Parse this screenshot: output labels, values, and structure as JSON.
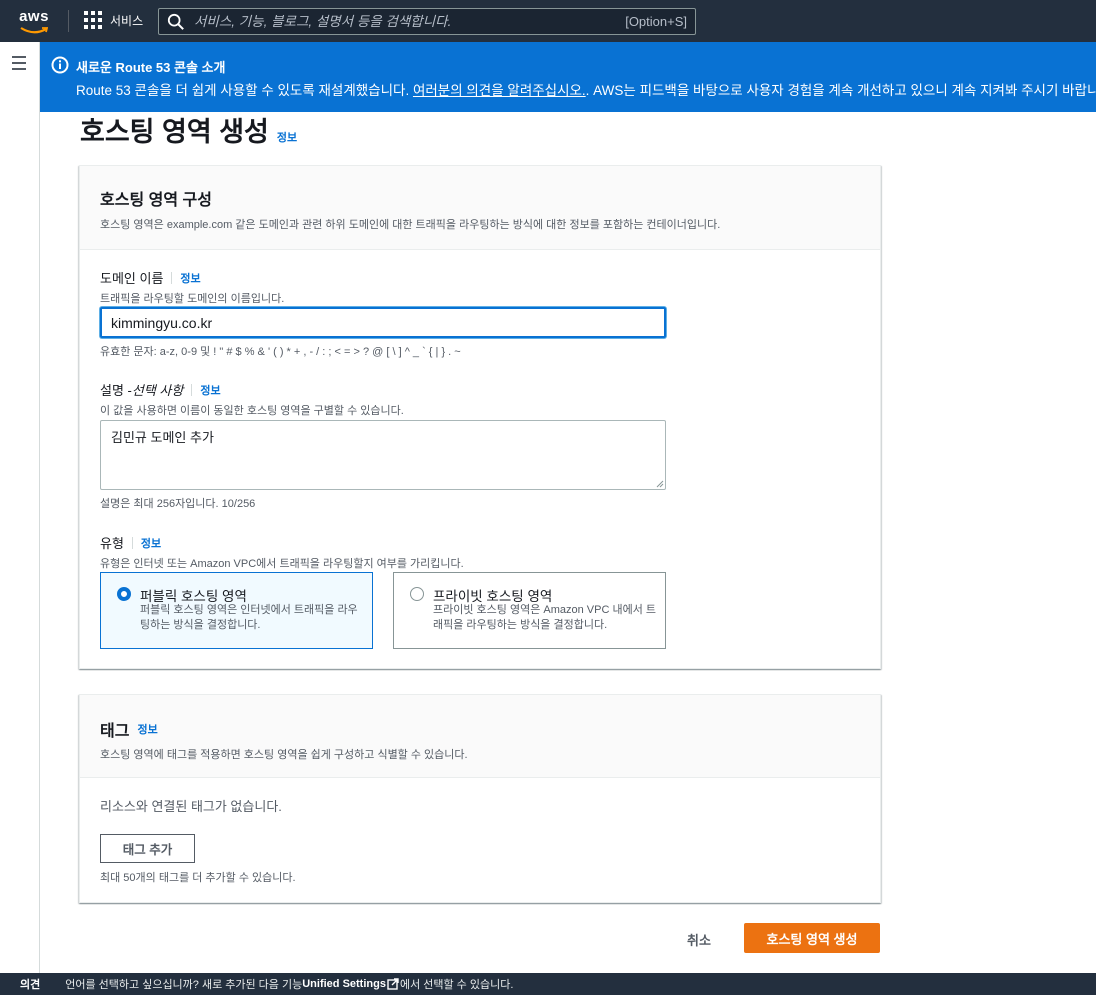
{
  "topnav": {
    "logo": "aws",
    "services_label": "서비스",
    "search_placeholder": "서비스, 기능, 블로그, 설명서 등을 검색합니다.",
    "search_shortcut": "[Option+S]"
  },
  "banner": {
    "title": "새로운 Route 53 콘솔 소개",
    "body_prefix": "Route 53 콘솔을 더 쉽게 사용할 수 있도록 재설계했습니다. ",
    "link": "여러분의 의견을 알려주십시오.",
    "body_suffix": ". AWS는 피드백을 바탕으로 사용자 경험을 계속 개선하고 있으니 계속 지켜봐 주시기 바랍니다."
  },
  "page": {
    "title": "호스팅 영역 생성",
    "info": "정보"
  },
  "config_panel": {
    "title": "호스팅 영역 구성",
    "description": "호스팅 영역은 example.com 같은 도메인과 관련 하위 도메인에 대한 트래픽을 라우팅하는 방식에 대한 정보를 포함하는 컨테이너입니다.",
    "domain": {
      "label": "도메인 이름",
      "info": "정보",
      "description": "트래픽을 라우팅할 도메인의 이름입니다.",
      "value": "kimmingyu.co.kr",
      "hint": "유효한 문자: a-z, 0-9 및 ! \" # $ % & ' ( ) * + , - / : ; < = > ? @ [ \\ ] ^ _ ` { | } . ~"
    },
    "description_field": {
      "label": "설명 - ",
      "label_optional": "선택 사항",
      "info": "정보",
      "description": "이 값을 사용하면 이름이 동일한 호스팅 영역을 구별할 수 있습니다.",
      "value": "김민규 도메인 추가",
      "hint": "설명은 최대 256자입니다. 10/256"
    },
    "type": {
      "label": "유형",
      "info": "정보",
      "description": "유형은 인터넷 또는 Amazon VPC에서 트래픽을 라우팅할지 여부를 가리킵니다.",
      "options": [
        {
          "title": "퍼블릭 호스팅 영역",
          "desc": "퍼블릭 호스팅 영역은 인터넷에서 트래픽을 라우팅하는 방식을 결정합니다.",
          "selected": true
        },
        {
          "title": "프라이빗 호스팅 영역",
          "desc": "프라이빗 호스팅 영역은 Amazon VPC 내에서 트래픽을 라우팅하는 방식을 결정합니다.",
          "selected": false
        }
      ]
    }
  },
  "tags_panel": {
    "title": "태그",
    "info": "정보",
    "description": "호스팅 영역에 태그를 적용하면 호스팅 영역을 쉽게 구성하고 식별할 수 있습니다.",
    "empty": "리소스와 연결된 태그가 없습니다.",
    "add_button": "태그 추가",
    "limit": "최대 50개의 태그를 더 추가할 수 있습니다."
  },
  "actions": {
    "cancel": "취소",
    "create": "호스팅 영역 생성"
  },
  "footer": {
    "feedback": "의견",
    "msg_prefix": "언어를 선택하고 싶으십니까? 새로 추가된 다음 기능",
    "msg_link": "Unified Settings",
    "msg_suffix": "에서 선택할 수 있습니다."
  },
  "colors": {
    "nav_bg": "#232f3e",
    "banner_bg": "#0972d3",
    "primary_button": "#ec7211",
    "link": "#0972d3"
  }
}
